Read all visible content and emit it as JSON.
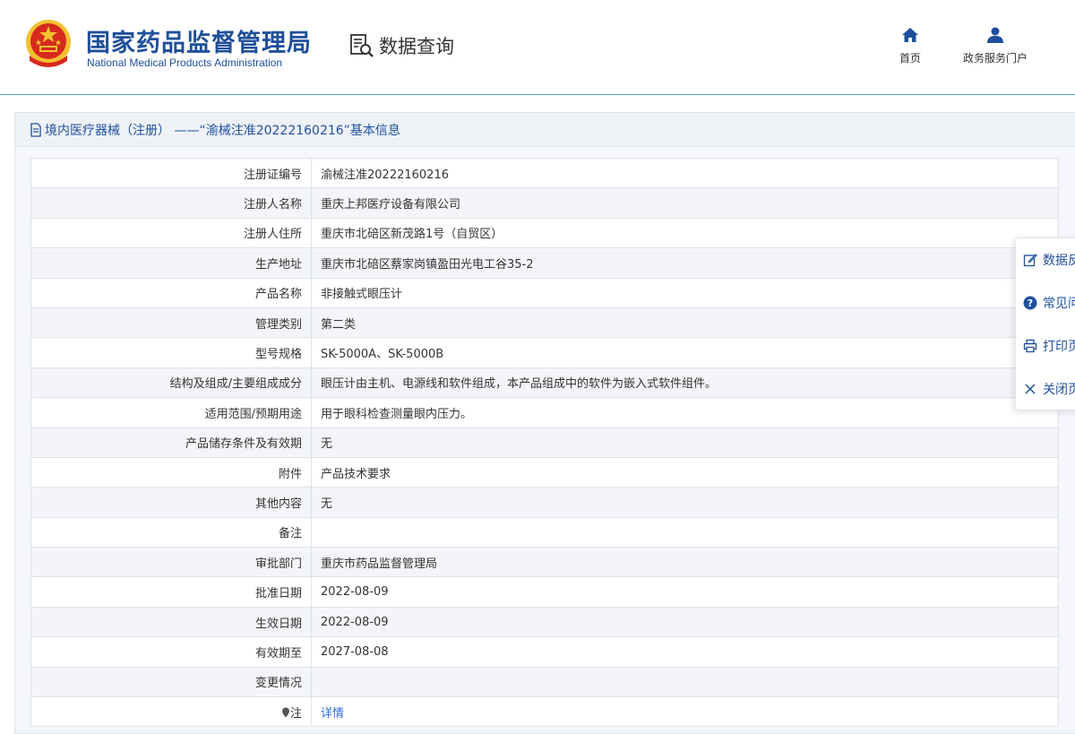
{
  "header": {
    "title_cn": "国家药品监督管理局",
    "title_en": "National Medical Products Administration",
    "section_title": "数据查询",
    "nav": [
      {
        "label": "首页",
        "icon": "home-icon"
      },
      {
        "label": "政务服务门户",
        "icon": "user-icon"
      }
    ]
  },
  "panel": {
    "title": "境内医疗器械（注册） ——“渝械注准20222160216”基本信息"
  },
  "rows": [
    {
      "label": "注册证编号",
      "value": "渝械注准20222160216"
    },
    {
      "label": "注册人名称",
      "value": "重庆上邦医疗设备有限公司"
    },
    {
      "label": "注册人住所",
      "value": "重庆市北碚区新茂路1号（自贸区）"
    },
    {
      "label": "生产地址",
      "value": "重庆市北碚区蔡家岗镇盈田光电工谷35-2"
    },
    {
      "label": "产品名称",
      "value": "非接触式眼压计"
    },
    {
      "label": "管理类别",
      "value": "第二类"
    },
    {
      "label": "型号规格",
      "value": "SK-5000A、SK-5000B"
    },
    {
      "label": "结构及组成/主要组成成分",
      "value": "眼压计由主机、电源线和软件组成，本产品组成中的软件为嵌入式软件组件。"
    },
    {
      "label": "适用范围/预期用途",
      "value": "用于眼科检查测量眼内压力。"
    },
    {
      "label": "产品储存条件及有效期",
      "value": "无"
    },
    {
      "label": "附件",
      "value": "产品技术要求"
    },
    {
      "label": "其他内容",
      "value": "无"
    },
    {
      "label": "备注",
      "value": ""
    },
    {
      "label": "审批部门",
      "value": "重庆市药品监督管理局"
    },
    {
      "label": "批准日期",
      "value": "2022-08-09"
    },
    {
      "label": "生效日期",
      "value": "2022-08-09"
    },
    {
      "label": "有效期至",
      "value": "2027-08-08"
    },
    {
      "label": "变更情况",
      "value": ""
    },
    {
      "label": "注",
      "value": "详情"
    }
  ],
  "side_menu": [
    {
      "label": "数据反",
      "icon": "edit-icon"
    },
    {
      "label": "常见问",
      "icon": "question-icon"
    },
    {
      "label": "打印页",
      "icon": "print-icon"
    },
    {
      "label": "关闭页",
      "icon": "close-icon"
    }
  ],
  "colors": {
    "brand_blue": "#1f4f9b",
    "link_blue": "#2d6bd6",
    "emblem_red": "#d62a1e",
    "emblem_gold": "#f2c230"
  }
}
